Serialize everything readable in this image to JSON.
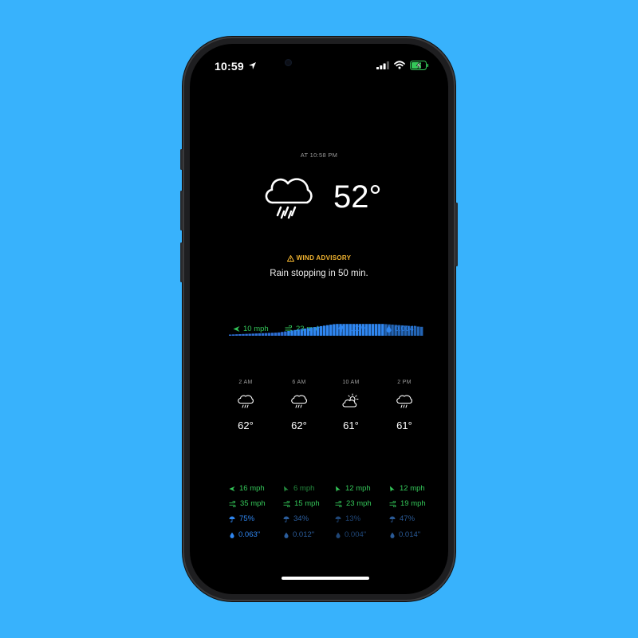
{
  "status": {
    "time": "10:59"
  },
  "current": {
    "at_time": "AT 10:58 PM",
    "temperature": "52°",
    "icon": "cloud-rain-icon",
    "advisory": "WIND ADVISORY",
    "summary": "Rain stopping in 50 min.",
    "wind": "10 mph",
    "gust": "23 mph",
    "precip_chance": "100%",
    "precip_amount": "0.004\""
  },
  "hourly": [
    {
      "time": "2 AM",
      "icon": "cloud-rain-icon",
      "temp": "62°",
      "wind": "16 mph",
      "gust": "35 mph",
      "chance": "75%",
      "amount": "0.063\""
    },
    {
      "time": "6 AM",
      "icon": "cloud-rain-icon",
      "temp": "62°",
      "wind": "6 mph",
      "gust": "15 mph",
      "chance": "34%",
      "amount": "0.012\""
    },
    {
      "time": "10 AM",
      "icon": "partly-cloudy-icon",
      "temp": "61°",
      "wind": "12 mph",
      "gust": "23 mph",
      "chance": "13%",
      "amount": "0.004\""
    },
    {
      "time": "2 PM",
      "icon": "cloud-rain-icon",
      "temp": "61°",
      "wind": "12 mph",
      "gust": "19 mph",
      "chance": "47%",
      "amount": "0.014\""
    }
  ],
  "colors": {
    "background": "#38b2fc",
    "wind_green": "#34c759",
    "precip_blue": "#2f86f0",
    "advisory_yellow": "#f5b731"
  }
}
